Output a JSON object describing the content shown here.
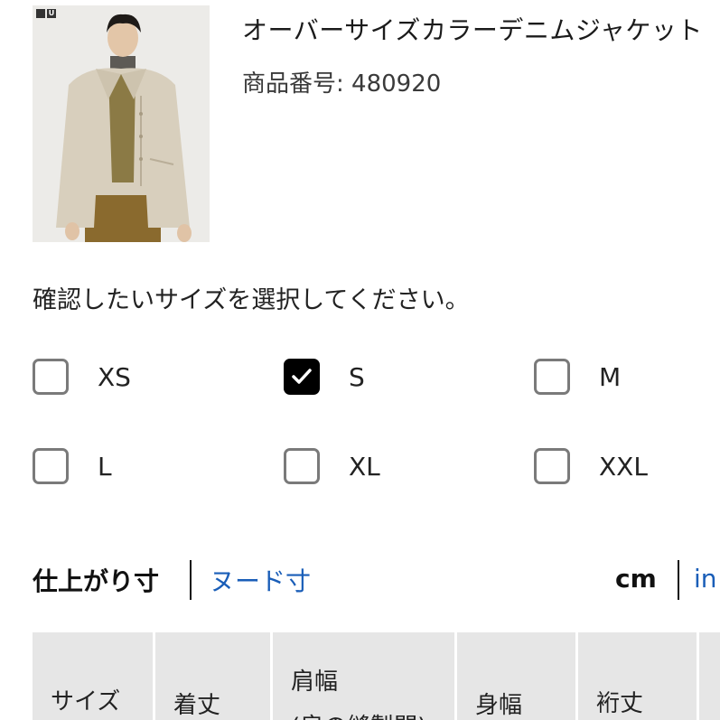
{
  "product": {
    "brand_logo": [
      "",
      "U"
    ],
    "image": "man-wearing-beige-oversized-denim-jacket",
    "title": "オーバーサイズカラーデニムジャケット",
    "code": "商品番号: 480920"
  },
  "size_selector": {
    "prompt": "確認したいサイズを選択してください。",
    "options": [
      {
        "label": "XS",
        "checked": false
      },
      {
        "label": "S",
        "checked": true
      },
      {
        "label": "M",
        "checked": false
      },
      {
        "label": "L",
        "checked": false
      },
      {
        "label": "XL",
        "checked": false
      },
      {
        "label": "XXL",
        "checked": false
      }
    ]
  },
  "measurement": {
    "garment_tab": "仕上がり寸",
    "body_tab": "ヌード寸",
    "unit_cm": "cm",
    "unit_in": "in"
  },
  "table": {
    "headers": {
      "size": "サイズ",
      "length": "着丈",
      "shoulder_line1": "肩幅",
      "shoulder_line2": "(肩の縫製間)",
      "body_width": "身幅",
      "sleeve": "裄丈"
    }
  },
  "colors": {
    "checked_box": "#000000",
    "unchecked_border": "#7a7a7a",
    "link": "#1a5eb8",
    "table_header_bg": "#e6e6e6"
  }
}
